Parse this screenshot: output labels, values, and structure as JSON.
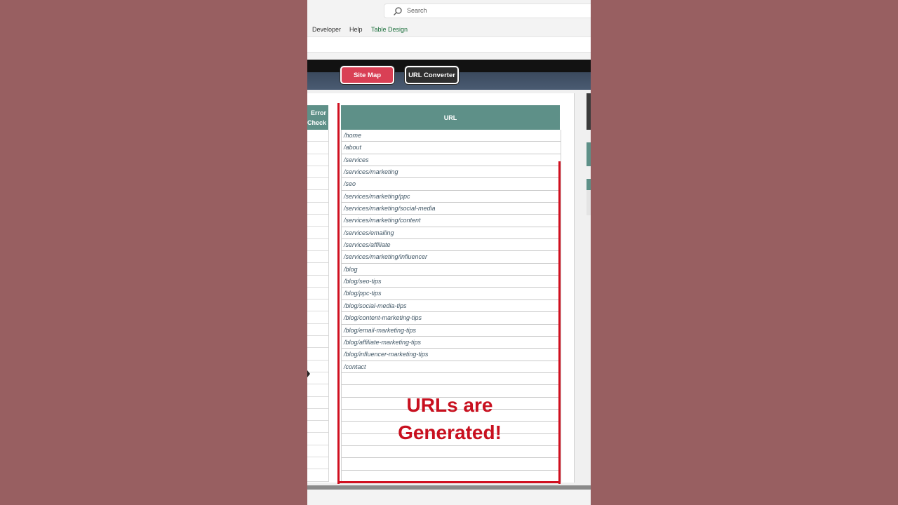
{
  "search": {
    "placeholder": "Search"
  },
  "ribbon": {
    "tabs": [
      "Developer",
      "Help",
      "Table Design"
    ]
  },
  "buttons": {
    "site_map": "Site Map",
    "url_converter": "URL Converter"
  },
  "columns": {
    "error_check_line1": "Error",
    "error_check_line2": "Check",
    "url": "URL"
  },
  "urls": [
    "/home",
    "/about",
    "/services",
    "/services/marketing",
    "/seo",
    "/services/marketing/ppc",
    "/services/marketing/social-media",
    "/services/marketing/content",
    "/services/emailing",
    "/services/affiliate",
    "/services/marketing/influencer",
    "/blog",
    "/blog/seo-tips",
    "/blog/ppc-tips",
    "/blog/social-media-tips",
    "/blog/content-marketing-tips",
    "/blog/email-marketing-tips",
    "/blog/affiliate-marketing-tips",
    "/blog/influencer-marketing-tips",
    "/contact",
    "",
    "",
    "",
    "",
    "",
    "",
    "",
    "",
    ""
  ],
  "overlay": {
    "line1": "URLs are",
    "line2": "Generated!"
  },
  "colors": {
    "accent_teal": "#5e9088",
    "site_map_red": "#d94055",
    "highlight_red": "#d00f1f"
  }
}
